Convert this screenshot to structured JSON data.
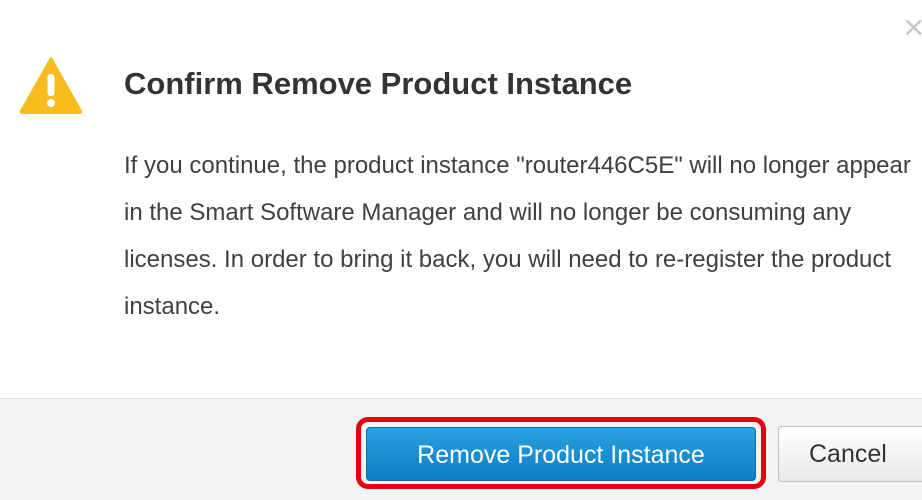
{
  "dialog": {
    "close_glyph": "×",
    "icon": "warning-triangle-icon",
    "title": "Confirm Remove Product Instance",
    "message": "If you continue, the product instance \"router446C5E\" will no longer appear in the Smart Software Manager and will no longer be consuming any licenses. In order to bring it back, you will need to re-register the product instance.",
    "primary_button": "Remove Product Instance",
    "cancel_button": "Cancel"
  },
  "colors": {
    "primary": "#1a8fd6",
    "highlight": "#e3000f",
    "warning": "#f6bb1c"
  }
}
